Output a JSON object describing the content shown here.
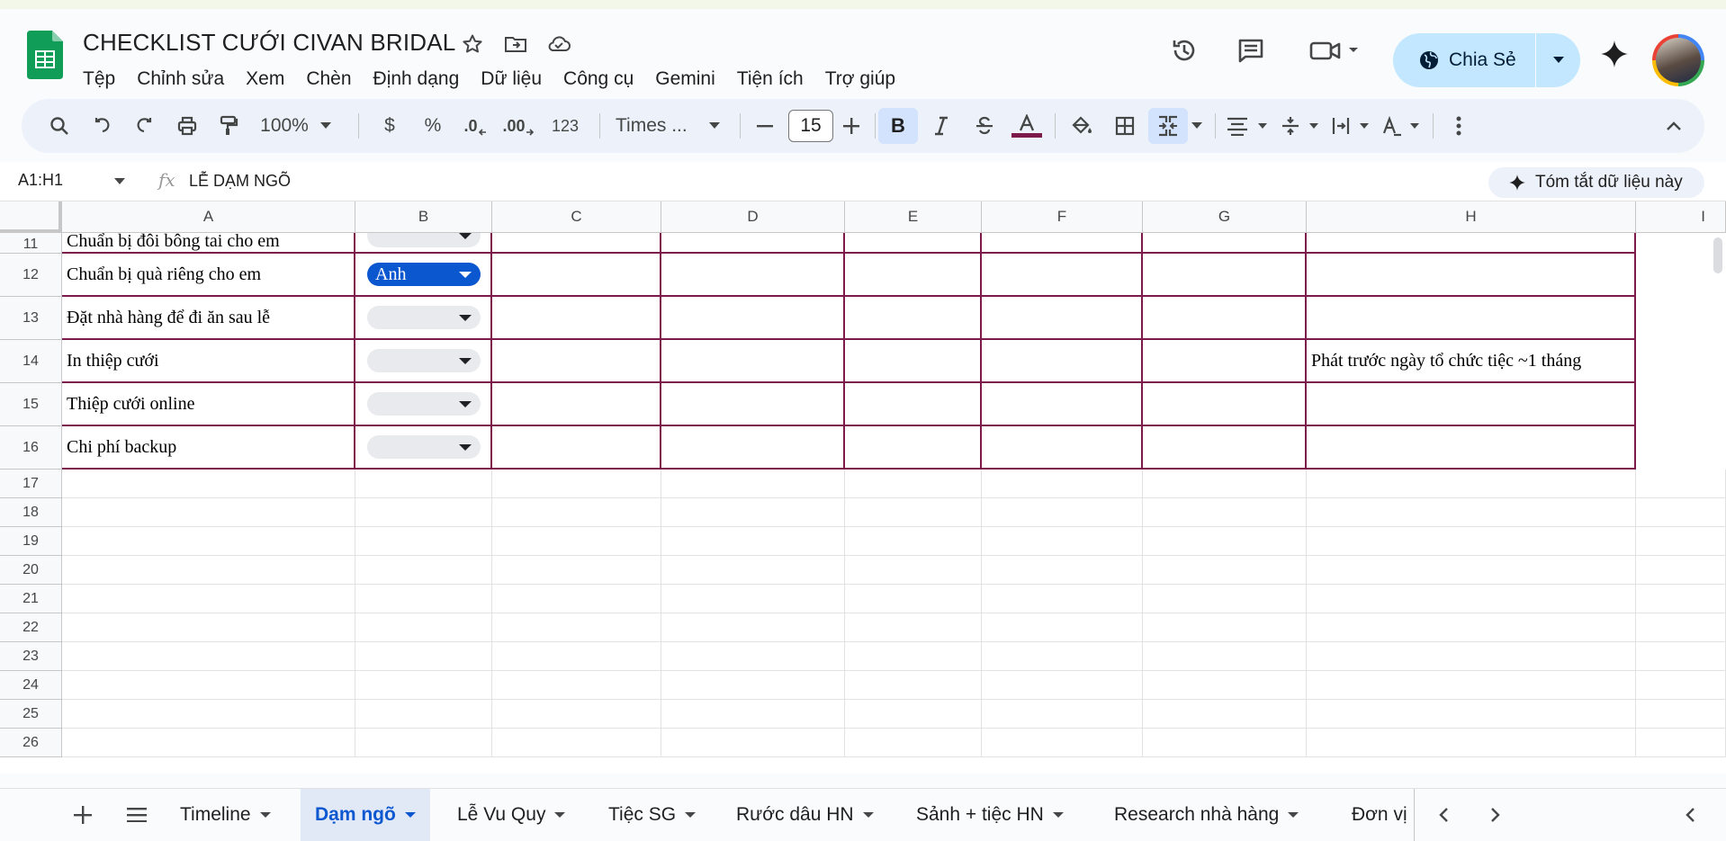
{
  "document": {
    "title": "CHECKLIST CƯỚI CIVAN BRIDAL"
  },
  "menu": [
    "Tệp",
    "Chỉnh sửa",
    "Xem",
    "Chèn",
    "Định dạng",
    "Dữ liệu",
    "Công cụ",
    "Gemini",
    "Tiện ích",
    "Trợ giúp"
  ],
  "header": {
    "share_label": "Chia Sẻ"
  },
  "toolbar": {
    "zoom": "100%",
    "currency": "$",
    "percent": "%",
    "dec_less": ".0",
    "dec_more": ".00",
    "number_format": "123",
    "font": "Times ...",
    "font_size": "15",
    "text_color": "#7b1a4b"
  },
  "formula_bar": {
    "name_box": "A1:H1",
    "fx": "fx",
    "value": "LỄ DẠM NGÕ",
    "summarize": "Tóm tắt dữ liệu này"
  },
  "grid": {
    "columns": [
      "A",
      "B",
      "C",
      "D",
      "E",
      "F",
      "G",
      "H",
      "I"
    ],
    "rows": [
      {
        "num": "11",
        "a": "Chuẩn bị đôi bông tai cho em",
        "b": "",
        "h": ""
      },
      {
        "num": "12",
        "a": "Chuẩn bị quà riêng cho em",
        "b": "Anh",
        "h": ""
      },
      {
        "num": "13",
        "a": "Đặt nhà hàng để đi ăn sau lễ",
        "b": "",
        "h": ""
      },
      {
        "num": "14",
        "a": "In thiệp cưới",
        "b": "",
        "h": "Phát trước ngày tổ chức tiệc ~1 tháng"
      },
      {
        "num": "15",
        "a": "Thiệp cưới online",
        "b": "",
        "h": ""
      },
      {
        "num": "16",
        "a": "Chi phí backup",
        "b": "",
        "h": ""
      }
    ],
    "empty_rows": [
      "17",
      "18",
      "19",
      "20",
      "21",
      "22",
      "23",
      "24",
      "25",
      "26"
    ]
  },
  "sheets": {
    "tabs": [
      "Timeline",
      "Dạm ngõ",
      "Lễ Vu Quy",
      "Tiệc SG",
      "Rước dâu HN",
      "Sảnh + tiệc HN",
      "Research nhà hàng",
      "Đơn vị"
    ],
    "active": "Dạm ngõ"
  },
  "colors": {
    "accent": "#0b57d0",
    "border": "#7b1a4b",
    "share_bg": "#c2e7ff"
  }
}
